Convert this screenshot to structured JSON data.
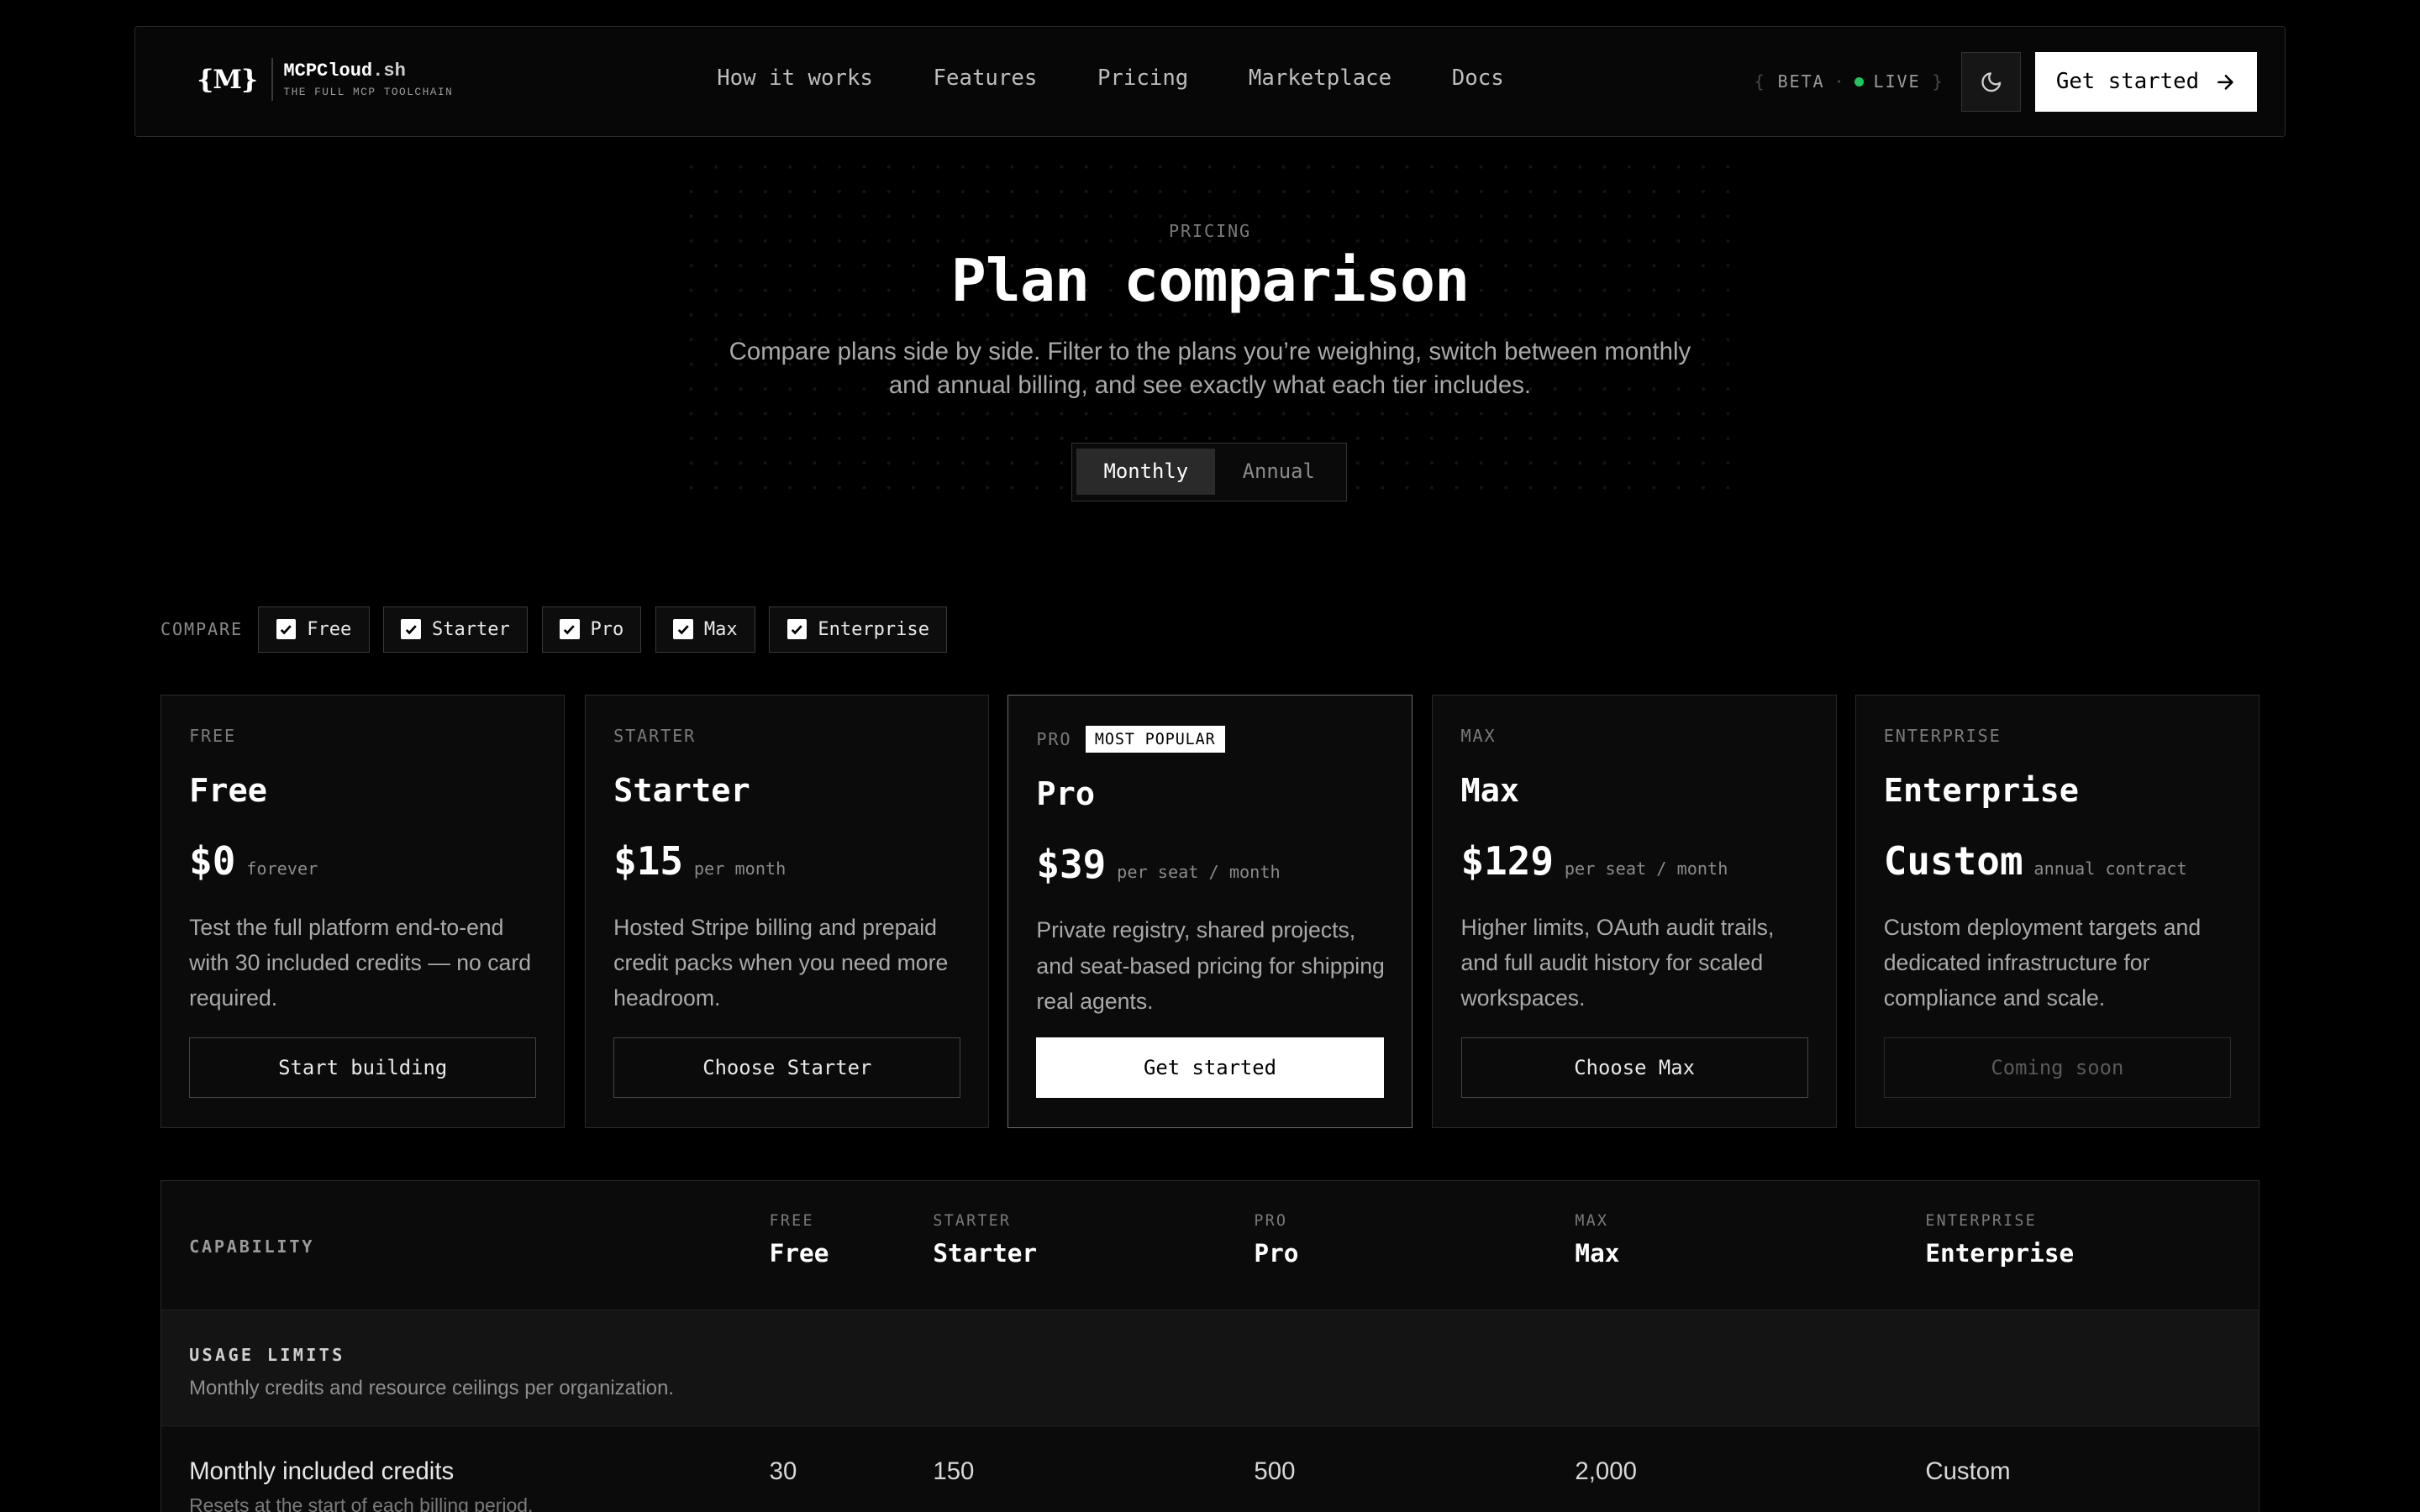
{
  "brand": {
    "mark": "{M}",
    "name": "MCPCloud",
    "tld": ".sh",
    "tagline": "THE FULL MCP TOOLCHAIN"
  },
  "nav": {
    "links": [
      "How it works",
      "Features",
      "Pricing",
      "Marketplace",
      "Docs"
    ],
    "status_beta": "BETA",
    "status_live": "LIVE",
    "theme_icon": "moon-icon",
    "cta_label": "Get started"
  },
  "hero": {
    "eyebrow": "PRICING",
    "title": "Plan comparison",
    "subtitle": "Compare plans side by side. Filter to the plans you’re weighing, switch between monthly and annual billing, and see exactly what each tier includes.",
    "billing_options": [
      "Monthly",
      "Annual"
    ],
    "billing_selected": "Monthly"
  },
  "compare": {
    "label": "COMPARE",
    "chips": [
      "Free",
      "Starter",
      "Pro",
      "Max",
      "Enterprise"
    ]
  },
  "plans": [
    {
      "tier": "FREE",
      "name": "Free",
      "price": "$0",
      "unit": "forever",
      "description": "Test the full platform end-to-end with 30 included credits — no card required.",
      "button": "Start building"
    },
    {
      "tier": "STARTER",
      "name": "Starter",
      "price": "$15",
      "unit": "per month",
      "description": "Hosted Stripe billing and prepaid credit packs when you need more headroom.",
      "button": "Choose Starter"
    },
    {
      "tier": "PRO",
      "badge": "MOST POPULAR",
      "name": "Pro",
      "price": "$39",
      "unit": "per seat / month",
      "description": "Private registry, shared projects, and seat-based pricing for shipping real agents.",
      "button": "Get started"
    },
    {
      "tier": "MAX",
      "name": "Max",
      "price": "$129",
      "unit": "per seat / month",
      "description": "Higher limits, OAuth audit trails, and full audit history for scaled workspaces.",
      "button": "Choose Max"
    },
    {
      "tier": "ENTERPRISE",
      "name": "Enterprise",
      "price": "Custom",
      "unit": "annual contract",
      "description": "Custom deployment targets and dedicated infrastructure for compliance and scale.",
      "button": "Coming soon"
    }
  ],
  "table": {
    "capability_label": "CAPABILITY",
    "columns": [
      {
        "tier": "FREE",
        "name": "Free"
      },
      {
        "tier": "STARTER",
        "name": "Starter"
      },
      {
        "tier": "PRO",
        "name": "Pro"
      },
      {
        "tier": "MAX",
        "name": "Max"
      },
      {
        "tier": "ENTERPRISE",
        "name": "Enterprise"
      }
    ],
    "section": {
      "title": "USAGE LIMITS",
      "subtitle": "Monthly credits and resource ceilings per organization."
    },
    "rows": [
      {
        "label": "Monthly included credits",
        "sublabel": "Resets at the start of each billing period.",
        "values": [
          "30",
          "150",
          "500",
          "2,000",
          "Custom"
        ]
      }
    ]
  },
  "colors": {
    "background": "#000000",
    "accent": "#ffffff",
    "live": "#22c55e"
  }
}
